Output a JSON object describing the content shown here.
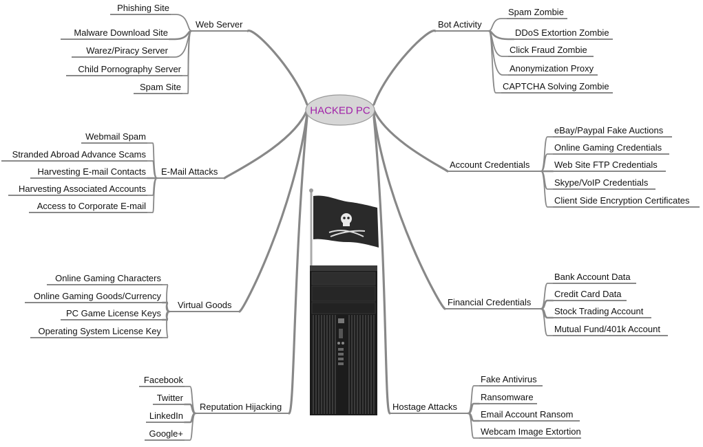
{
  "center": {
    "label": "HACKED PC",
    "color": "#a020a8",
    "fill": "#d6d6d6"
  },
  "branches": [
    {
      "key": "web-server",
      "label": "Web Server",
      "children": [
        "Phishing Site",
        "Malware Download Site",
        "Warez/Piracy Server",
        "Child Pornography Server",
        "Spam Site"
      ]
    },
    {
      "key": "email-attacks",
      "label": "E-Mail Attacks",
      "children": [
        "Webmail Spam",
        "Stranded Abroad Advance Scams",
        "Harvesting E-mail Contacts",
        "Harvesting Associated Accounts",
        "Access to Corporate E-mail"
      ]
    },
    {
      "key": "virtual-goods",
      "label": "Virtual Goods",
      "children": [
        "Online Gaming Characters",
        "Online Gaming Goods/Currency",
        "PC Game License Keys",
        "Operating System License Key"
      ]
    },
    {
      "key": "reputation-hijacking",
      "label": "Reputation Hijacking",
      "children": [
        "Facebook",
        "Twitter",
        "LinkedIn",
        "Google+"
      ]
    },
    {
      "key": "bot-activity",
      "label": "Bot Activity",
      "children": [
        "Spam Zombie",
        "DDoS Extortion Zombie",
        "Click Fraud Zombie",
        "Anonymization Proxy",
        "CAPTCHA Solving Zombie"
      ]
    },
    {
      "key": "account-credentials",
      "label": "Account Credentials",
      "children": [
        "eBay/Paypal Fake Auctions",
        "Online Gaming Credentials",
        "Web Site FTP Credentials",
        "Skype/VoIP Credentials",
        "Client Side Encryption Certificates"
      ]
    },
    {
      "key": "financial-credentials",
      "label": "Financial Credentials",
      "children": [
        "Bank Account Data",
        "Credit Card Data",
        "Stock Trading Account",
        "Mutual Fund/401k Account"
      ]
    },
    {
      "key": "hostage-attacks",
      "label": "Hostage Attacks",
      "children": [
        "Fake Antivirus",
        "Ransomware",
        "Email Account Ransom",
        "Webcam Image Extortion"
      ]
    }
  ],
  "illustration": {
    "flag": "pirate-flag-icon",
    "computer": "desktop-tower-icon"
  }
}
